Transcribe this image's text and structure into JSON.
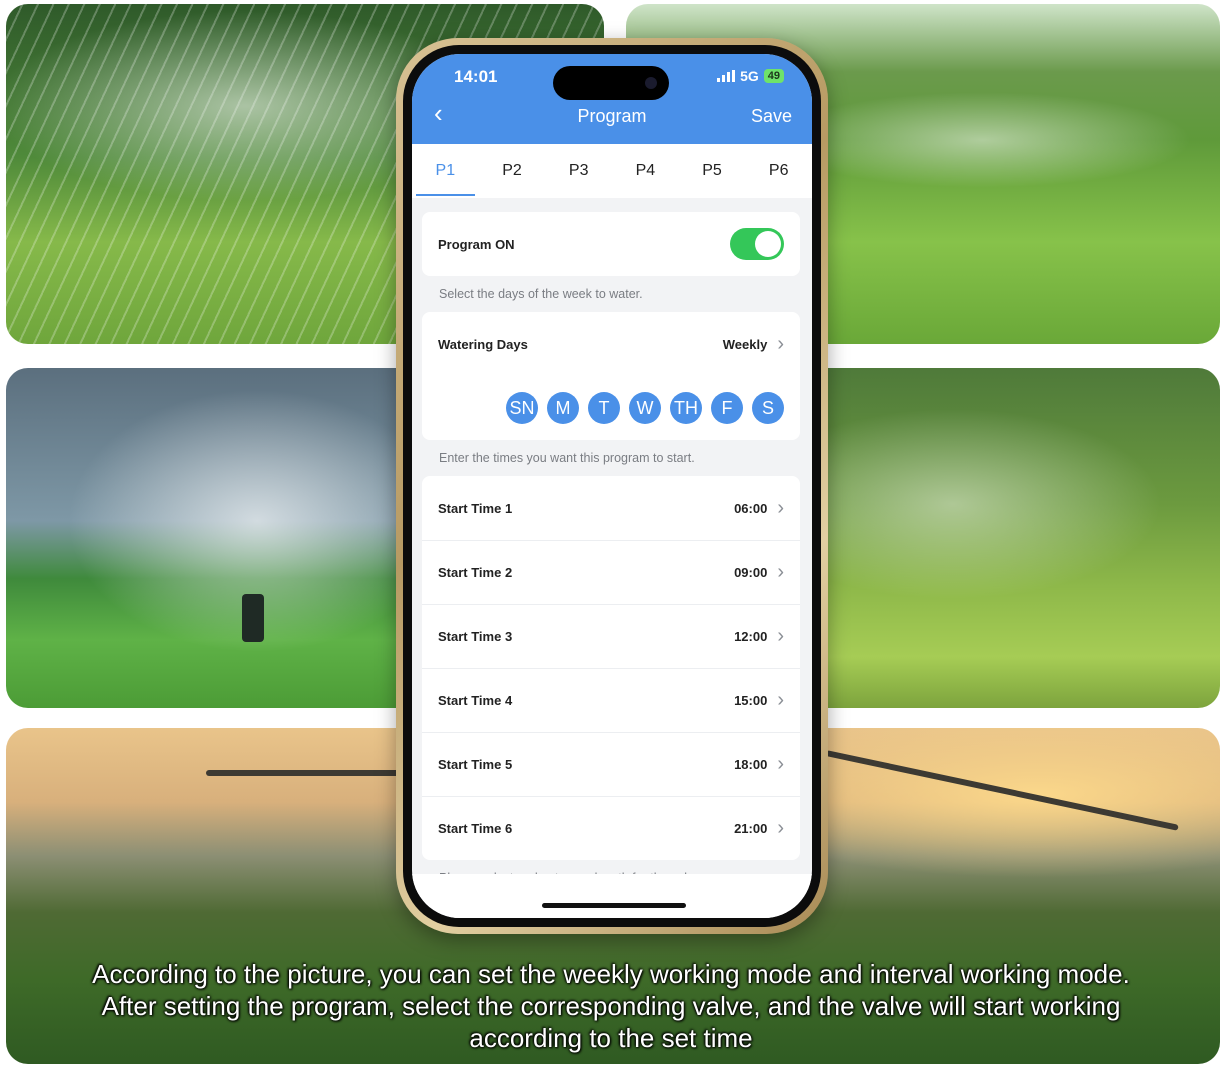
{
  "caption": {
    "line1": "According to the picture, you can set the weekly working mode and interval working mode.",
    "line2": "After setting the program, select the corresponding valve, and the valve will start working",
    "line3": "according to the set time"
  },
  "status_bar": {
    "time": "14:01",
    "network": "5G",
    "battery": "49"
  },
  "nav": {
    "back_icon": "chevron-left-icon",
    "title": "Program",
    "save_label": "Save"
  },
  "tabs": [
    {
      "label": "P1",
      "active": true
    },
    {
      "label": "P2",
      "active": false
    },
    {
      "label": "P3",
      "active": false
    },
    {
      "label": "P4",
      "active": false
    },
    {
      "label": "P5",
      "active": false
    },
    {
      "label": "P6",
      "active": false
    }
  ],
  "program_on": {
    "label": "Program ON",
    "enabled": true
  },
  "days_hint": "Select the days of the week to water.",
  "watering_days": {
    "label": "Watering Days",
    "value": "Weekly"
  },
  "days": [
    "SN",
    "M",
    "T",
    "W",
    "TH",
    "F",
    "S"
  ],
  "times_hint": "Enter the times you want this program to start.",
  "start_times": [
    {
      "label": "Start Time 1",
      "value": "06:00"
    },
    {
      "label": "Start Time 2",
      "value": "09:00"
    },
    {
      "label": "Start Time 3",
      "value": "12:00"
    },
    {
      "label": "Start Time 4",
      "value": "15:00"
    },
    {
      "label": "Start Time 5",
      "value": "18:00"
    },
    {
      "label": "Start Time 6",
      "value": "21:00"
    }
  ],
  "run_length_hint": "Please select and enter run length for the valve you",
  "colors": {
    "accent": "#4a90e8",
    "toggle_on": "#34c759"
  }
}
